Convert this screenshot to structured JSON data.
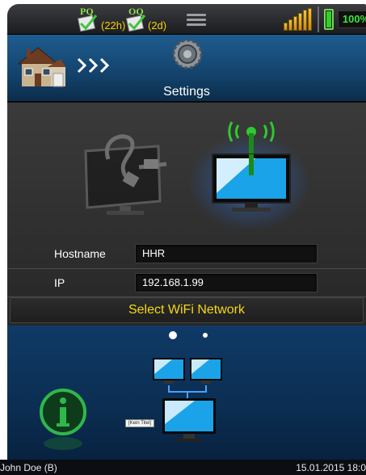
{
  "statusbar": {
    "pq": {
      "code": "PQ",
      "age": "(22h)"
    },
    "oq": {
      "code": "OQ",
      "age": "(2d)"
    },
    "menu_icon": "hamburger-menu-icon",
    "signal_icon": "signal-strength-icon",
    "battery_icon": "battery-icon",
    "battery_percent": "100%",
    "battery_level": 1.0
  },
  "header": {
    "home_icon": "house-icon",
    "breadcrumb_icon": "chevrons-right-icon",
    "section_icon": "gear-icon",
    "title": "Settings"
  },
  "connection": {
    "wired_icon": "ethernet-monitor-icon",
    "wifi_icon": "wifi-monitor-icon",
    "selected": "wifi"
  },
  "fields": [
    {
      "label": "Hostname",
      "value": "HHR"
    },
    {
      "label": "IP",
      "value": "192.168.1.99"
    }
  ],
  "select_wifi_label": "Select WiFi Network",
  "pager": {
    "pages": 2,
    "current": 0
  },
  "bottom": {
    "info_icon": "info-icon",
    "network_icon": "network-monitors-icon",
    "tooltip": "[Kein Titel]"
  },
  "footer": {
    "user": "John Doe (B)",
    "datetime": "15.01.2015 18:0"
  },
  "colors": {
    "accent_yellow": "#f5d816",
    "battery_green": "#36e83a",
    "header_blue": "#14456f"
  }
}
